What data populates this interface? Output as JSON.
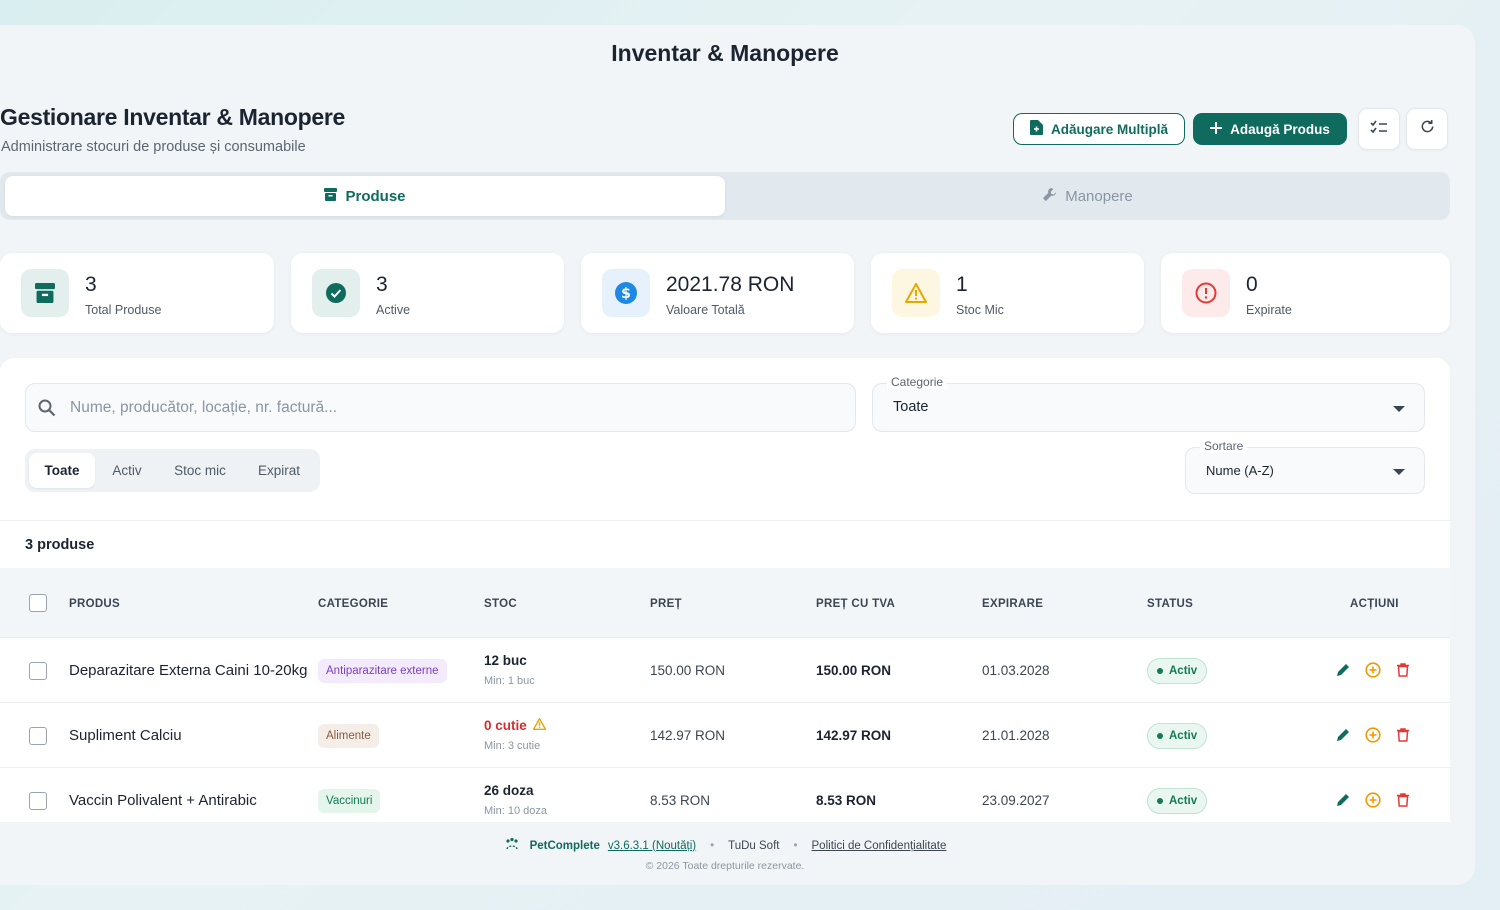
{
  "app": {
    "title": "Inventar & Manopere"
  },
  "header": {
    "title": "Gestionare Inventar & Manopere",
    "subtitle": "Administrare stocuri de produse și consumabile",
    "bulk_add_label": "Adăugare Multiplă",
    "add_product_label": "Adaugă Produs"
  },
  "tabs": [
    {
      "label": "Produse",
      "icon": "archive-icon",
      "active": true
    },
    {
      "label": "Manopere",
      "icon": "wrench-icon",
      "active": false
    }
  ],
  "stats": [
    {
      "value": "3",
      "label": "Total Produse",
      "icon": "archive-icon",
      "color": "#0f6b5e",
      "bg": "#e3efed"
    },
    {
      "value": "3",
      "label": "Active",
      "icon": "check-circle-icon",
      "color": "#0f6b5e",
      "bg": "#e3efed"
    },
    {
      "value": "2021.78 RON",
      "label": "Valoare Totală",
      "icon": "dollar-circle-icon",
      "color": "#1e88e5",
      "bg": "#e6f1fb"
    },
    {
      "value": "1",
      "label": "Stoc Mic",
      "icon": "warning-icon",
      "color": "#e6a800",
      "bg": "#fdf6e0"
    },
    {
      "value": "0",
      "label": "Expirate",
      "icon": "alert-circle-icon",
      "color": "#e53935",
      "bg": "#fdeaea"
    }
  ],
  "filters": {
    "search_placeholder": "Nume, producător, locație, nr. factură...",
    "category_label": "Categorie",
    "category_value": "Toate",
    "sort_label": "Sortare",
    "sort_value": "Nume (A-Z)",
    "chips": [
      "Toate",
      "Activ",
      "Stoc mic",
      "Expirat"
    ],
    "active_chip": "Toate"
  },
  "table": {
    "count_text": "3 produse",
    "columns": [
      "PRODUS",
      "CATEGORIE",
      "STOC",
      "PREȚ",
      "PREȚ CU TVA",
      "EXPIRARE",
      "STATUS",
      "ACȚIUNI"
    ],
    "rows": [
      {
        "name": "Deparazitare Externa Caini 10-20kg",
        "category": "Antiparazitare externe",
        "cat_color": "#7b3fbf",
        "cat_bg": "#f3eafc",
        "stock": "12 buc",
        "stock_min": "Min: 1 buc",
        "low": false,
        "price": "150.00 RON",
        "price_tva": "150.00 RON",
        "expiry": "01.03.2028",
        "status": "Activ"
      },
      {
        "name": "Supliment Calciu",
        "category": "Alimente",
        "cat_color": "#8a5a3c",
        "cat_bg": "#f5ede8",
        "stock": "0 cutie",
        "stock_min": "Min: 3 cutie",
        "low": true,
        "price": "142.97 RON",
        "price_tva": "142.97 RON",
        "expiry": "21.01.2028",
        "status": "Activ"
      },
      {
        "name": "Vaccin Polivalent + Antirabic",
        "category": "Vaccinuri",
        "cat_color": "#137a55",
        "cat_bg": "#e4f5ec",
        "stock": "26 doza",
        "stock_min": "Min: 10 doza",
        "low": false,
        "price": "8.53 RON",
        "price_tva": "8.53 RON",
        "expiry": "23.09.2027",
        "status": "Activ"
      }
    ]
  },
  "footer": {
    "brand": "PetComplete",
    "version": "v3.6.3.1 (Noutăți)",
    "company": "TuDu Soft",
    "policy": "Politici de Confidențialitate",
    "copyright": "© 2026 Toate drepturile rezervate."
  }
}
